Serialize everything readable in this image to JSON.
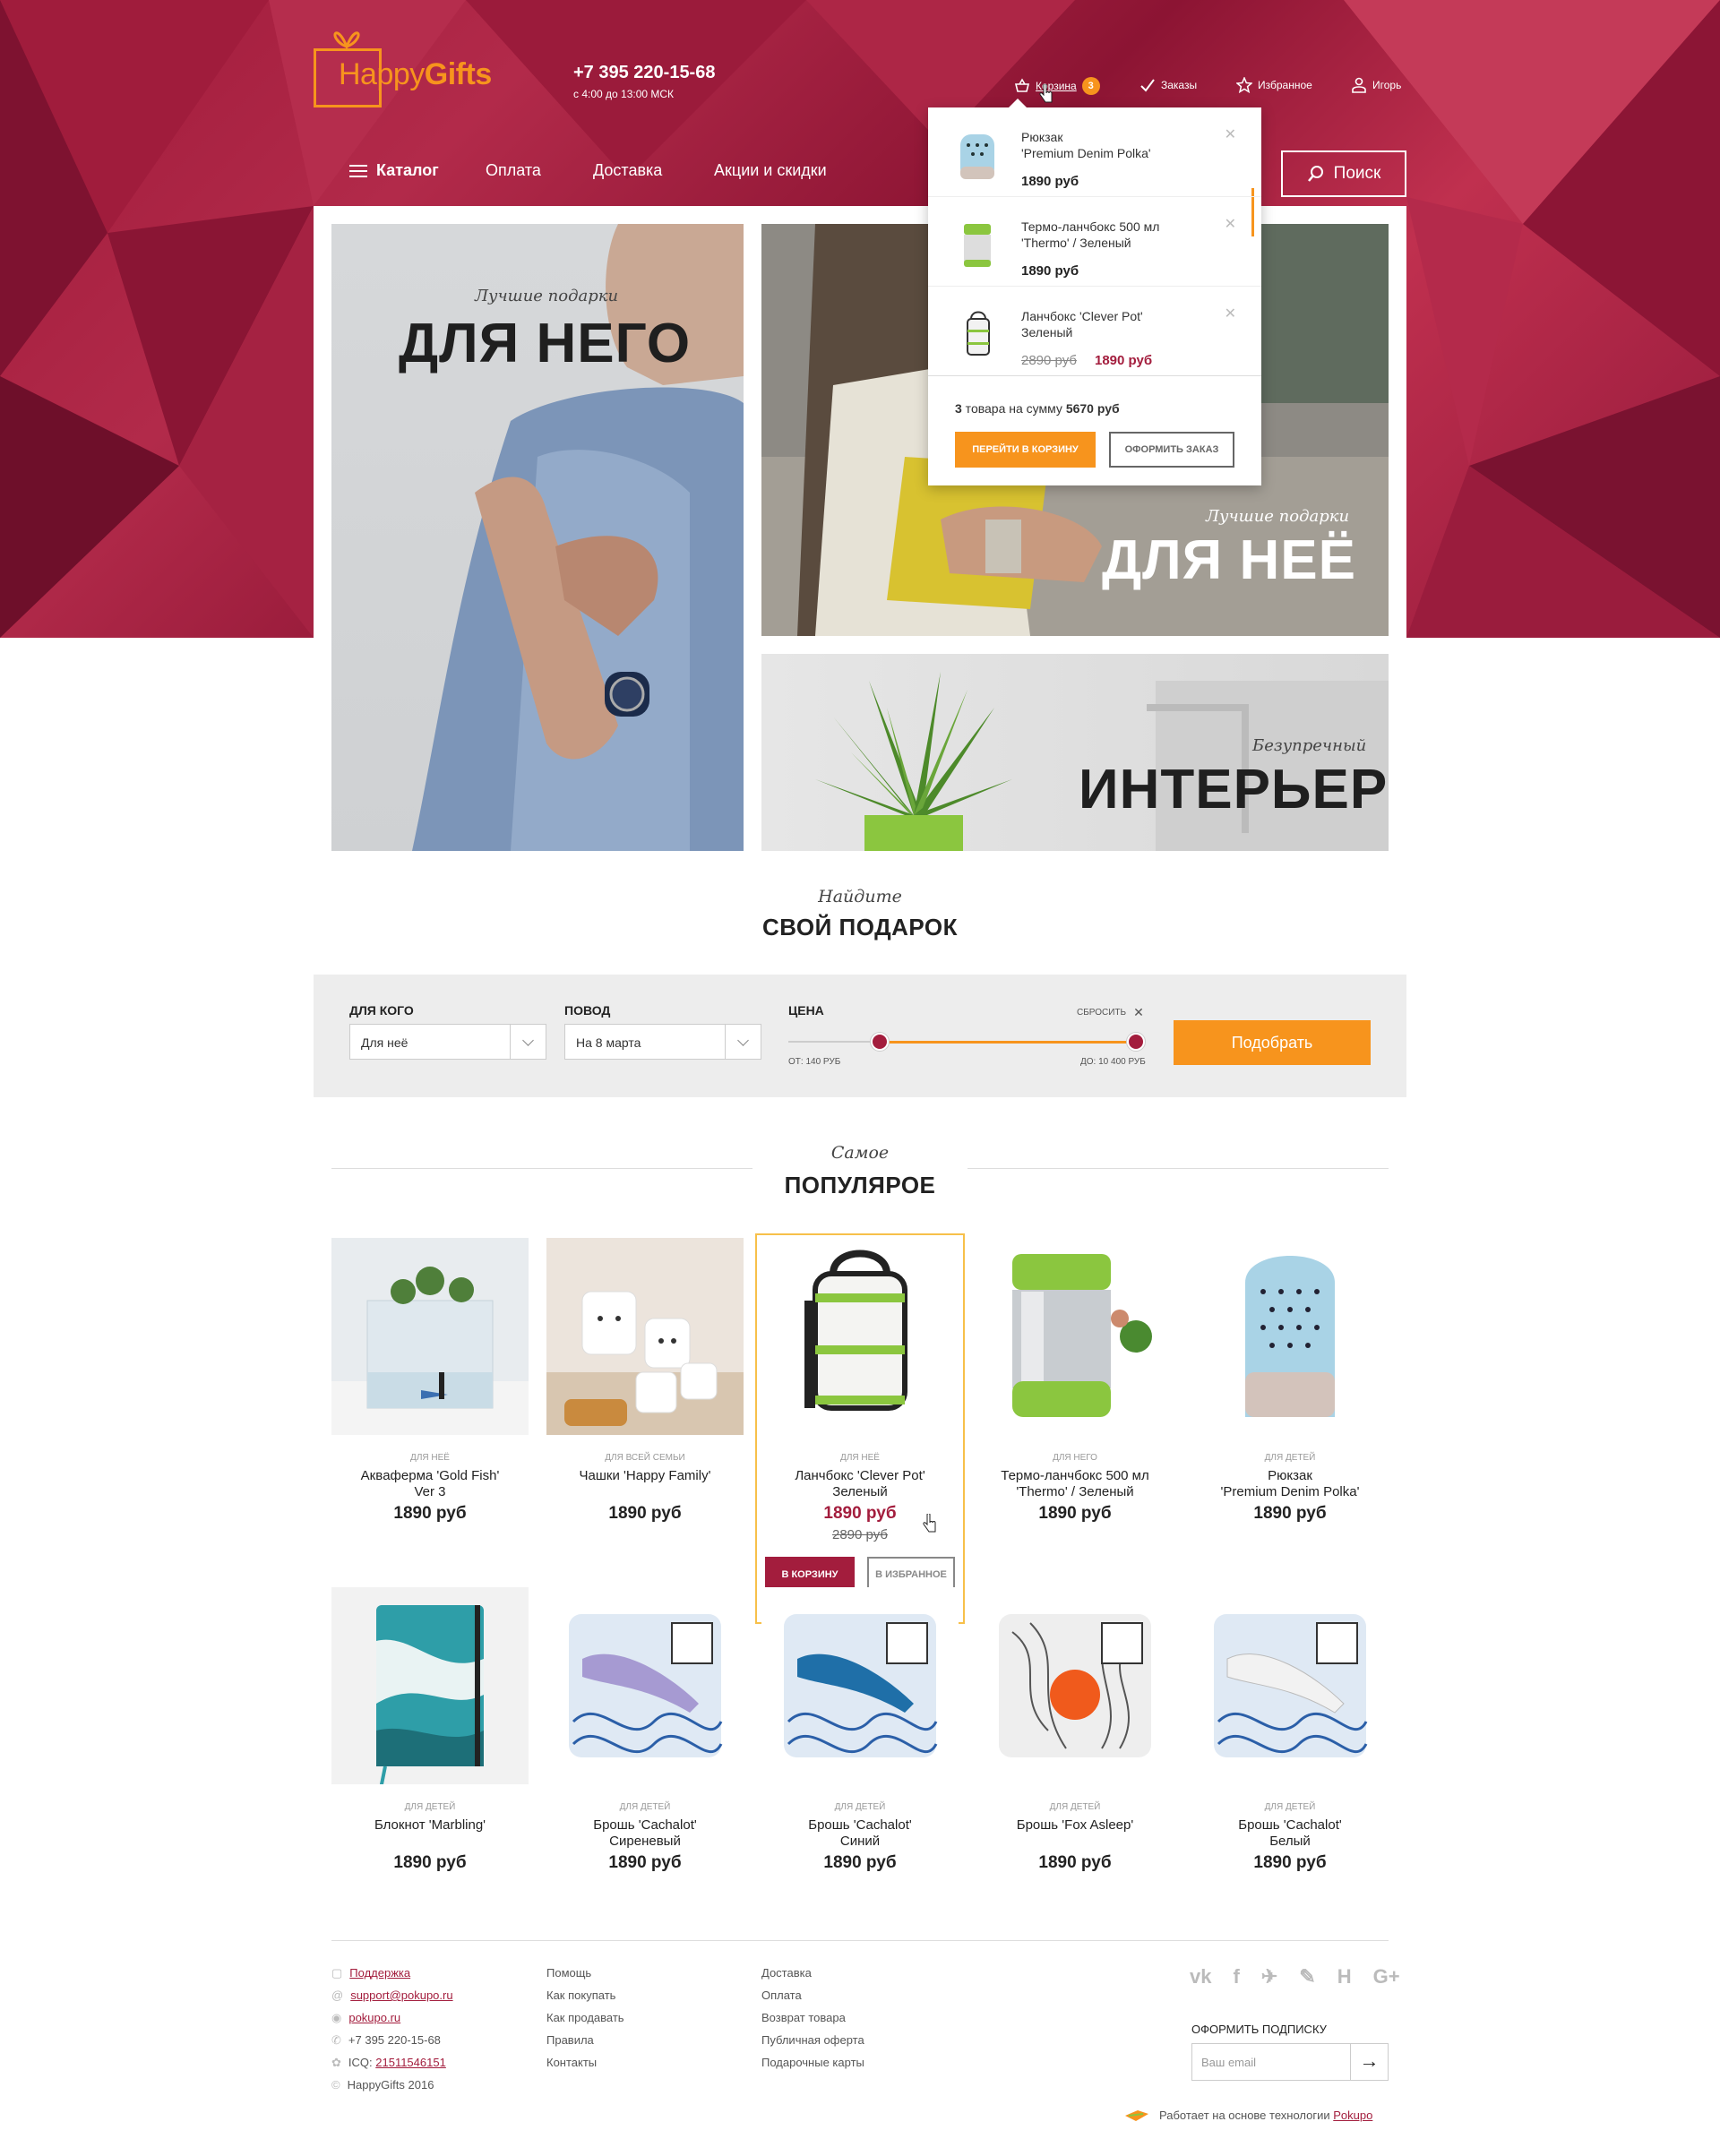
{
  "brand": {
    "name_light": "Happy",
    "name_bold": "Gifts"
  },
  "header": {
    "phone": "+7 395 220-15-68",
    "hours": "с 4:00 до 13:00 МСК",
    "cart_label": "Корзина",
    "cart_count": "3",
    "orders_label": "Заказы",
    "favorites_label": "Избранное",
    "user_label": "Игорь"
  },
  "nav": {
    "catalog": "Каталог",
    "payment": "Оплата",
    "delivery": "Доставка",
    "promo": "Акции и скидки",
    "search": "Поиск"
  },
  "cart_popup": {
    "items": [
      {
        "name": "Рюкзак\n'Premium Denim Polka'",
        "price": "1890 руб"
      },
      {
        "name": "Термо-ланчбокс 500 мл\n'Thermo' / Зеленый",
        "price": "1890 руб"
      },
      {
        "name": "Ланчбокс 'Clever Pot'\nЗеленый",
        "old_price": "2890 руб",
        "price": "1890 руб"
      }
    ],
    "summary_prefix": "3",
    "summary_text": " товара на сумму ",
    "summary_total": "5670 руб",
    "go_cart": "ПЕРЕЙТИ В КОРЗИНУ",
    "checkout": "ОФОРМИТЬ ЗАКАЗ"
  },
  "banners": {
    "him_sub": "Лучшие подарки",
    "him_title": "ДЛЯ НЕГО",
    "her_sub": "Лучшие подарки",
    "her_title": "ДЛЯ НЕЁ",
    "interior_sub": "Безупречный",
    "interior_title": "ИНТЕРЬЕР"
  },
  "find": {
    "sub": "Найдите",
    "title": "СВОЙ ПОДАРОК"
  },
  "filter": {
    "for_whom_label": "ДЛЯ КОГО",
    "for_whom_value": "Для неё",
    "occasion_label": "ПОВОД",
    "occasion_value": "На 8 марта",
    "price_label": "ЦЕНА",
    "reset": "СБРОСИТЬ",
    "from": "ОТ: 140 РУБ",
    "to": "ДО: 10 400 РУБ",
    "submit": "Подобрать"
  },
  "popular": {
    "sub": "Самое",
    "title": "ПОПУЛЯРОЕ"
  },
  "products": [
    {
      "cat": "ДЛЯ НЕЁ",
      "name": "Аквaферма 'Gold Fish'\nVer 3",
      "price": "1890 руб"
    },
    {
      "cat": "ДЛЯ ВСЕЙ СЕМЬИ",
      "name": "Чашки 'Happy Family'",
      "price": "1890 руб"
    },
    {
      "cat": "ДЛЯ НЕЁ",
      "name": "Ланчбокс 'Clever Pot'\nЗеленый",
      "price": "1890 руб",
      "old_price": "2890 руб",
      "to_cart": "В КОРЗИНУ",
      "to_fav": "В ИЗБРАННОЕ"
    },
    {
      "cat": "ДЛЯ НЕГО",
      "name": "Термо-ланчбокс 500 мл\n'Thermo' / Зеленый",
      "price": "1890 руб"
    },
    {
      "cat": "ДЛЯ ДЕТЕЙ",
      "name": "Рюкзак\n'Premium Denim Polka'",
      "price": "1890 руб"
    },
    {
      "cat": "ДЛЯ ДЕТЕЙ",
      "name": "Блокнот 'Marbling'",
      "price": "1890 руб"
    },
    {
      "cat": "ДЛЯ ДЕТЕЙ",
      "name": "Брошь 'Cachalot'\nСиреневый",
      "price": "1890 руб"
    },
    {
      "cat": "ДЛЯ ДЕТЕЙ",
      "name": "Брошь 'Cachalot'\nСиний",
      "price": "1890 руб"
    },
    {
      "cat": "ДЛЯ ДЕТЕЙ",
      "name": "Брошь 'Fox Asleep'",
      "price": "1890 руб"
    },
    {
      "cat": "ДЛЯ ДЕТЕЙ",
      "name": "Брошь 'Cachalot'\nБелый",
      "price": "1890 руб"
    }
  ],
  "footer": {
    "col1": [
      "Поддержка",
      "support@pokupo.ru",
      "pokupo.ru",
      "+7 395 220-15-68",
      "ICQ: ",
      "21511546151",
      "HappyGifts 2016"
    ],
    "col2": [
      "Помощь",
      "Как покупать",
      "Как продавать",
      "Правила",
      "Контакты"
    ],
    "col3": [
      "Доставка",
      "Оплата",
      "Возврат товара",
      "Публичная оферта",
      "Подарочные карты"
    ],
    "social": [
      "vk",
      "f",
      "twitter",
      "skype",
      "h",
      "G+"
    ],
    "subscribe_label": "ОФОРМИТЬ ПОДПИСКУ",
    "email_placeholder": "Ваш email",
    "powered_prefix": "Работает на основе технологии ",
    "powered_link": "Pokupo"
  },
  "colors": {
    "accent": "#f7941d",
    "brand": "#a31d3d"
  }
}
